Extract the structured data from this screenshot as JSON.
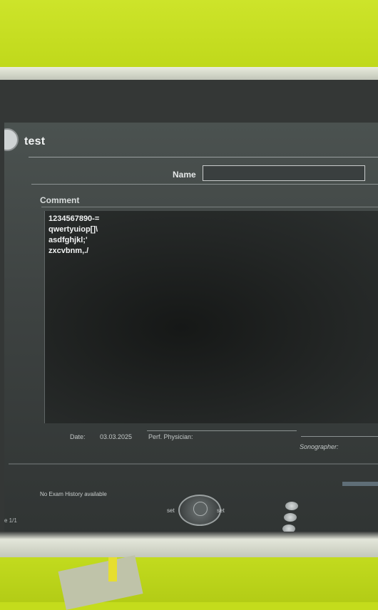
{
  "window": {
    "title": "test"
  },
  "form": {
    "name_label": "Name",
    "name_value": "",
    "comment_label": "Comment",
    "comment_text": "1234567890-=\nqwertyuiop[]\\\nasdfghjkl;'\nzxcvbnm,./"
  },
  "footer": {
    "date_label": "Date:",
    "date_value": "03.03.2025",
    "perf_label": "Perf. Physician:",
    "sonographer_label": "Sonographer:"
  },
  "status": {
    "history_text": "No Exam History available",
    "page_text": "e 1/1"
  },
  "controls": {
    "set_left": "set",
    "set_right": "set"
  },
  "colors": {
    "wall": "#c4dc1c",
    "screen": "#3e4342",
    "text": "#f1f3f3"
  },
  "icons": {
    "window_icon": "app-logo-icon",
    "dial_icon": "trackball-icon"
  }
}
